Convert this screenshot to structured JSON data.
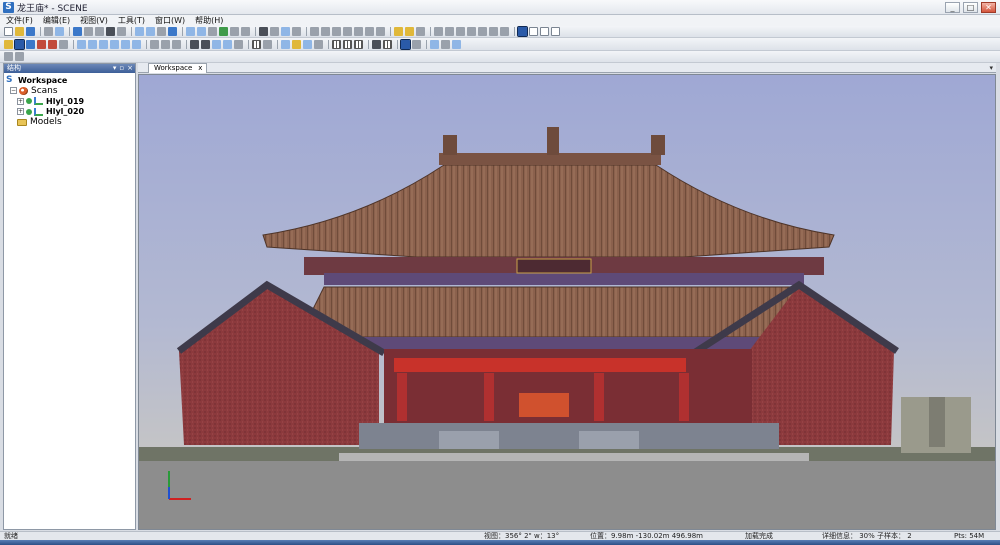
{
  "window": {
    "title": "龙王庙* - SCENE",
    "controls": [
      "_",
      "□",
      "✕"
    ]
  },
  "menu": [
    "文件(F)",
    "编辑(E)",
    "视图(V)",
    "工具(T)",
    "窗口(W)",
    "帮助(H)"
  ],
  "panel": {
    "header": "结构",
    "header_buttons": [
      "▾",
      "▫",
      "×"
    ],
    "tree": {
      "root": "Workspace",
      "scans_label": "Scans",
      "scans": [
        "Hlyl_019",
        "Hlyl_020"
      ],
      "models_label": "Models"
    }
  },
  "view": {
    "tab_label": "Workspace",
    "tab_close": "x",
    "tab_menu": "▾"
  },
  "statusbar": {
    "ready": "就绪",
    "view": "视图：356° 2\" w：13°",
    "position": "位置：9.98m -130.02m 496.98m",
    "loading": "加载完成",
    "detail": "详细信息： 30%  子样本： 2",
    "points": "Pts: 54M"
  },
  "colors": {
    "accent": "#2f6fbf",
    "sky_top": "#9fa8d4",
    "roof": "#8a5f4a",
    "wall": "#8c3a3a",
    "banner": "#c8322a"
  }
}
